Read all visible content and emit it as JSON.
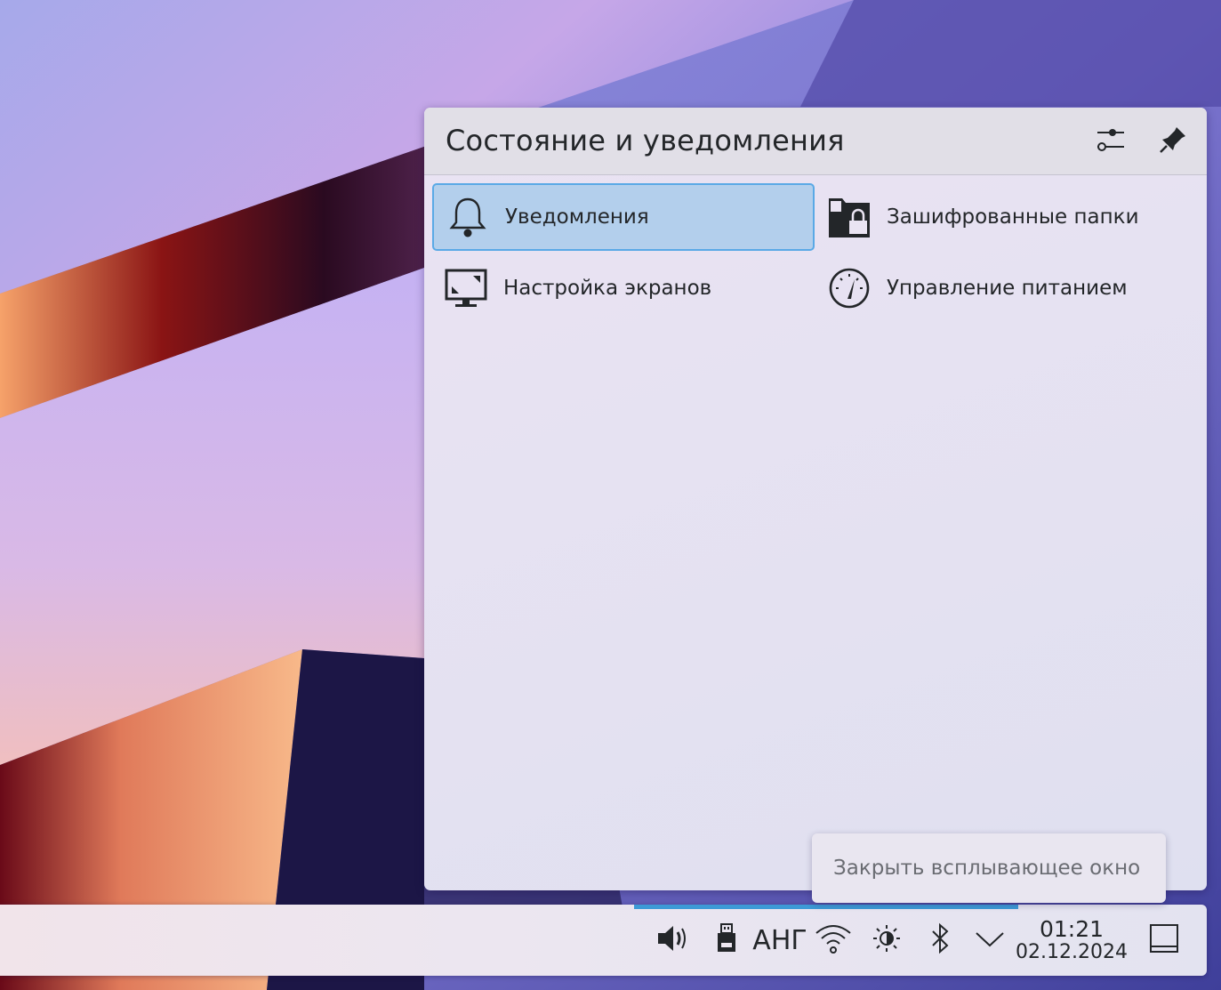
{
  "popup": {
    "title": "Состояние и уведомления",
    "config_icon": "configure-sliders-icon",
    "pin_icon": "pin-icon"
  },
  "tiles": [
    {
      "label": "Уведомления",
      "icon": "bell-icon",
      "selected": true
    },
    {
      "label": "Зашифрованные папки",
      "icon": "encrypted-folder-icon",
      "selected": false
    },
    {
      "label": "Настройка экранов",
      "icon": "display-icon",
      "selected": false
    },
    {
      "label": "Управление питанием",
      "icon": "power-gauge-icon",
      "selected": false
    }
  ],
  "tooltip": {
    "text": "Закрыть всплывающее окно"
  },
  "panel": {
    "tray": {
      "volume_icon": "volume-icon",
      "usb_icon": "usb-drive-icon",
      "keyboard_layout": "АНГ",
      "wifi_icon": "wifi-icon",
      "brightness_icon": "brightness-icon",
      "bluetooth_icon": "bluetooth-icon",
      "expand_icon": "chevron-down-icon"
    },
    "clock": {
      "time": "01:21",
      "date": "02.12.2024"
    },
    "show_desktop_icon": "show-desktop-icon"
  },
  "colors": {
    "selected_tile_bg": "#b3cfec",
    "selected_tile_border": "#5aa9e6",
    "panel_highlight": "#3d9ad6",
    "text": "#232629"
  }
}
